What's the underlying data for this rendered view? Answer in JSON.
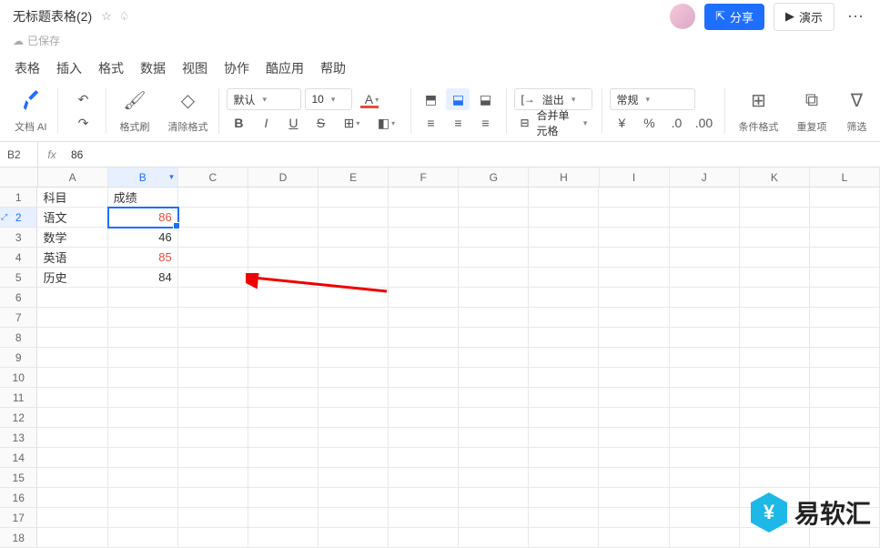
{
  "title": "无标题表格(2)",
  "saved": "已保存",
  "shareLabel": "分享",
  "presentLabel": "演示",
  "menu": {
    "m0": "表格",
    "m1": "插入",
    "m2": "格式",
    "m3": "数据",
    "m4": "视图",
    "m5": "协作",
    "m6": "酷应用",
    "m7": "帮助"
  },
  "tb": {
    "docai": "文档 AI",
    "fmtpaint": "格式刷",
    "clearfmt": "清除格式",
    "font": "默认",
    "size": "10",
    "overflow": "溢出",
    "numfmt": "常规",
    "merge": "合并单元格",
    "condfmt": "条件格式",
    "dup": "重复项",
    "filter": "筛选",
    "more": "更多"
  },
  "cellref": "B2",
  "cellval": "86",
  "cols": [
    "A",
    "B",
    "C",
    "D",
    "E",
    "F",
    "G",
    "H",
    "I",
    "J",
    "K",
    "L"
  ],
  "rows": [
    "1",
    "2",
    "3",
    "4",
    "5",
    "6",
    "7",
    "8",
    "9",
    "10",
    "11",
    "12",
    "13",
    "14",
    "15",
    "16",
    "17",
    "18"
  ],
  "cells": {
    "A1": "科目",
    "B1": "成绩",
    "A2": "语文",
    "B2": "86",
    "A3": "数学",
    "B3": "46",
    "A4": "英语",
    "B4": "85",
    "A5": "历史",
    "B5": "84"
  },
  "redCells": [
    "B2",
    "B4"
  ],
  "selectedCell": "B2",
  "selectedCol": "B",
  "selectedRow": "2",
  "watermark": "易软汇"
}
